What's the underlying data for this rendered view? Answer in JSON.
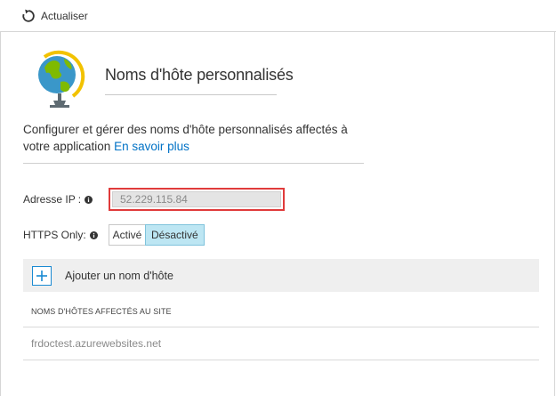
{
  "toolbar": {
    "refresh_label": "Actualiser"
  },
  "header": {
    "title": "Noms d'hôte personnalisés",
    "icon": "globe-icon"
  },
  "description": {
    "text": "Configurer et gérer des noms d'hôte personnalisés affectés à votre application",
    "link_label": "En savoir plus"
  },
  "ip_field": {
    "label": "Adresse IP :",
    "value": "52.229.115.84"
  },
  "https_only": {
    "label": "HTTPS Only:",
    "options": [
      "Activé",
      "Désactivé"
    ],
    "selected": "Désactivé"
  },
  "add_hostname": {
    "label": "Ajouter un nom d'hôte"
  },
  "hostnames_table": {
    "header": "NOMS D'HÔTES AFFECTÉS AU SITE",
    "rows": [
      "frdoctest.azurewebsites.net"
    ]
  },
  "colors": {
    "accent": "#0072c6",
    "highlight_border": "#e03b3b",
    "toggle_selected": "#bde6f3"
  }
}
